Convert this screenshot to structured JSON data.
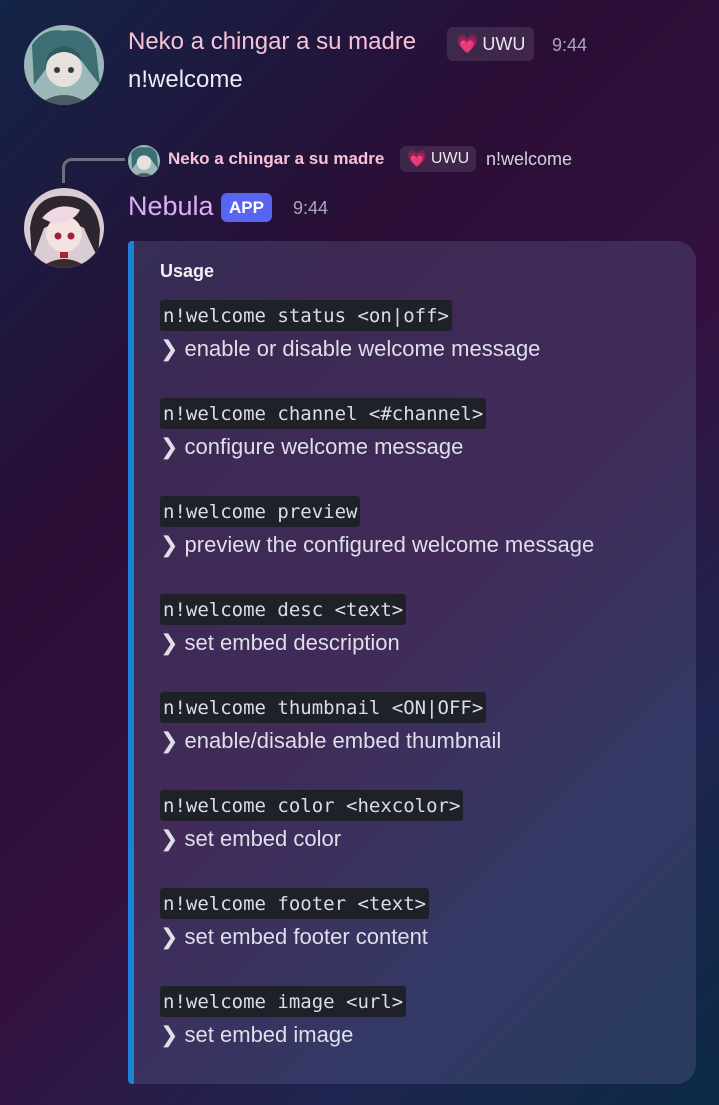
{
  "message1": {
    "author": "Neko a chingar a su madre",
    "badge": "UWU",
    "badge_icon": "heart-icon",
    "time": "9:44",
    "content": "n!welcome"
  },
  "reply": {
    "author": "Neko a chingar a su madre",
    "badge": "UWU",
    "content": "n!welcome"
  },
  "message2": {
    "author": "Nebula",
    "app_badge": "APP",
    "time": "9:44",
    "embed": {
      "accent_color": "#1b83d6",
      "title": "Usage",
      "items": [
        {
          "command": "n!welcome status <on|off>",
          "description": "❯ enable or disable welcome message"
        },
        {
          "command": "n!welcome channel <#channel>",
          "description": "❯ configure welcome message"
        },
        {
          "command": "n!welcome preview",
          "description": "❯ preview the configured welcome message"
        },
        {
          "command": "n!welcome desc <text>",
          "description": "❯ set embed description"
        },
        {
          "command": "n!welcome thumbnail <ON|OFF>",
          "description": "❯ enable/disable embed thumbnail"
        },
        {
          "command": "n!welcome color <hexcolor>",
          "description": "❯ set embed color"
        },
        {
          "command": "n!welcome footer <text>",
          "description": "❯ set embed footer content"
        },
        {
          "command": "n!welcome image <url>",
          "description": "❯ set embed image"
        }
      ]
    }
  },
  "colors": {
    "user_name": "#f7c2d8",
    "bot_name": "#dcaef7",
    "app_badge": "#5865f2"
  }
}
